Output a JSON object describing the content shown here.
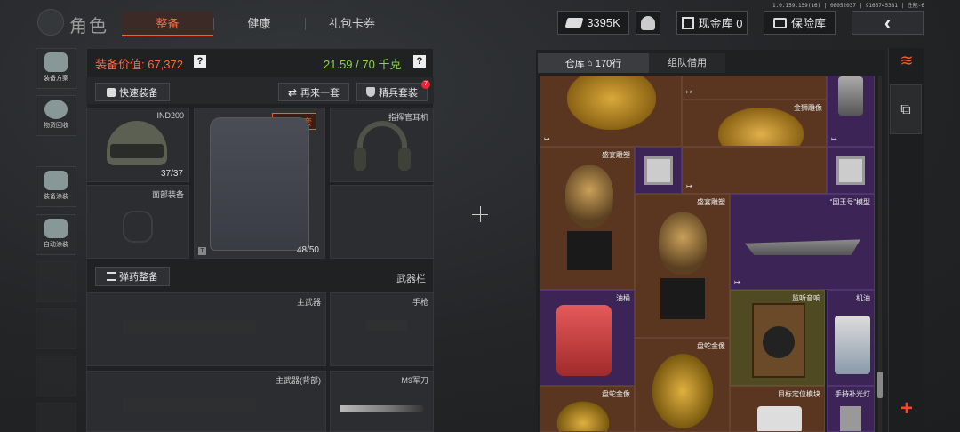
{
  "version": "1.0.159.159(16) | 08052037 | 9166745381 | 性能-6",
  "title": "角色",
  "tabs": [
    {
      "label": "整备"
    },
    {
      "label": "健康"
    },
    {
      "label": "礼包卡券"
    }
  ],
  "topbar": {
    "currency": "3395K",
    "cash_vault": "现金库 0",
    "safe_vault": "保险库"
  },
  "sidebar": [
    {
      "label": "装备方案"
    },
    {
      "label": "物资回收"
    },
    {
      "label": "装备涂装"
    },
    {
      "label": "自动涂装"
    }
  ],
  "loadout": {
    "value_label": "装备价值: 67,372",
    "weight": "21.59 / 70 千克",
    "quick_equip": "快速装备",
    "repeat": "再来一套",
    "elite": "精兵套装",
    "elite_badge": "7",
    "helmet_name": "IND200",
    "helmet_durability": "37/37",
    "armor_tag": "再来一套",
    "armor_durability": "48/50",
    "headset_name": "指挥官耳机",
    "face_name": "面部装备",
    "ammo_button": "弹药整备",
    "weapons_label": "武器栏",
    "primary": "主武器",
    "pistol": "手枪",
    "primary_back": "主武器(背部)",
    "melee": "M9军刀"
  },
  "warehouse": {
    "tab": "仓库",
    "count": "170行",
    "tab2": "组队借用",
    "items": [
      {
        "name": ""
      },
      {
        "name": "金狮雕像"
      },
      {
        "name": "盛宴雕塑"
      },
      {
        "name": "盛宴雕塑"
      },
      {
        "name": "“国王号”模型"
      },
      {
        "name": "油桶"
      },
      {
        "name": "盘蛇金像"
      },
      {
        "name": "监听音响"
      },
      {
        "name": "机油"
      },
      {
        "name": "盘蛇金像"
      },
      {
        "name": "目标定位模块"
      },
      {
        "name": "手持补光灯"
      }
    ]
  }
}
